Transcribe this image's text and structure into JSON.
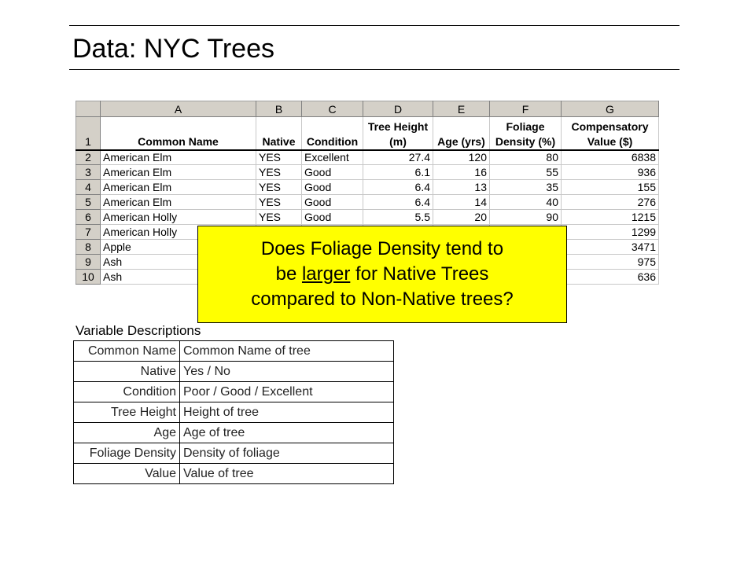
{
  "slide": {
    "title": "Data: NYC Trees"
  },
  "spreadsheet": {
    "column_letters": [
      "A",
      "B",
      "C",
      "D",
      "E",
      "F",
      "G"
    ],
    "header_row_number": "1",
    "headers": [
      "Common Name",
      "Native",
      "Condition",
      "Tree Height (m)",
      "Age (yrs)",
      "Foliage Density (%)",
      "Compensatory Value ($)"
    ],
    "rows": [
      {
        "row": "2",
        "common_name": "American Elm",
        "native": "YES",
        "condition": "Excellent",
        "height": "27.4",
        "age": "120",
        "foliage": "80",
        "value": "6838"
      },
      {
        "row": "3",
        "common_name": "American Elm",
        "native": "YES",
        "condition": "Good",
        "height": "6.1",
        "age": "16",
        "foliage": "55",
        "value": "936"
      },
      {
        "row": "4",
        "common_name": "American Elm",
        "native": "YES",
        "condition": "Good",
        "height": "6.4",
        "age": "13",
        "foliage": "35",
        "value": "155"
      },
      {
        "row": "5",
        "common_name": "American Elm",
        "native": "YES",
        "condition": "Good",
        "height": "6.4",
        "age": "14",
        "foliage": "40",
        "value": "276"
      },
      {
        "row": "6",
        "common_name": "American Holly",
        "native": "YES",
        "condition": "Good",
        "height": "5.5",
        "age": "20",
        "foliage": "90",
        "value": "1215"
      },
      {
        "row": "7",
        "common_name": "American Holly",
        "native": "",
        "condition": "",
        "height": "",
        "age": "",
        "foliage": "",
        "value": "1299"
      },
      {
        "row": "8",
        "common_name": "Apple",
        "native": "",
        "condition": "",
        "height": "",
        "age": "",
        "foliage": "",
        "value": "3471"
      },
      {
        "row": "9",
        "common_name": "Ash",
        "native": "",
        "condition": "",
        "height": "",
        "age": "",
        "foliage": "",
        "value": "975"
      },
      {
        "row": "10",
        "common_name": "Ash",
        "native": "",
        "condition": "",
        "height": "",
        "age": "",
        "foliage": "",
        "value": "636"
      }
    ]
  },
  "callout": {
    "line1": "Does Foliage Density tend to",
    "line2_pre": "be ",
    "line2_emph": "larger",
    "line2_post": " for Native Trees",
    "line3": "compared to Non-Native trees?",
    "background": "#ffff00"
  },
  "variables": {
    "title": "Variable Descriptions",
    "items": [
      {
        "name": "Common Name",
        "desc": "Common Name of tree"
      },
      {
        "name": "Native",
        "desc": "Yes / No"
      },
      {
        "name": "Condition",
        "desc": "Poor / Good / Excellent"
      },
      {
        "name": "Tree Height",
        "desc": "Height of tree"
      },
      {
        "name": "Age",
        "desc": "Age of tree"
      },
      {
        "name": "Foliage Density",
        "desc": "Density of foliage"
      },
      {
        "name": "Value",
        "desc": "Value of tree"
      }
    ]
  }
}
